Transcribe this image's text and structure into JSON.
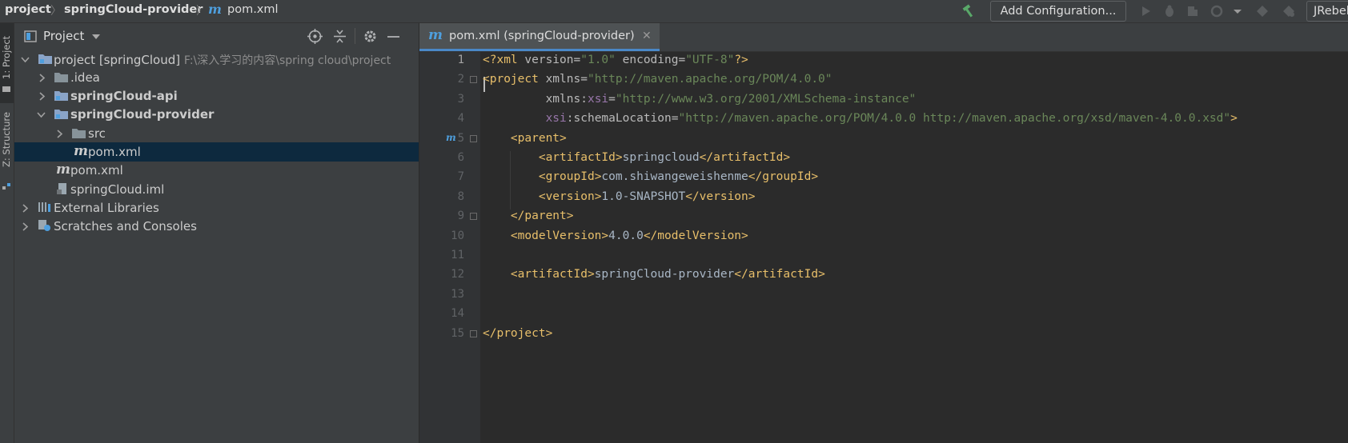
{
  "breadcrumb": {
    "root": "project",
    "module": "springCloud-provider",
    "file": "pom.xml"
  },
  "toolbar": {
    "add_configuration": "Add Configuration...",
    "jrebel": "JRebel",
    "icons": [
      "build-hammer-icon",
      "run-icon",
      "debug-icon",
      "coverage-icon",
      "profile-icon",
      "dropdown-icon",
      "jrebel-run-icon",
      "jrebel-debug-icon"
    ]
  },
  "stripe": {
    "project_label": "1: Project",
    "structure_label": "Z: Structure"
  },
  "project_panel": {
    "title": "Project",
    "tree": [
      {
        "label": "project [springCloud]",
        "path": "F:\\深入学习的内容\\spring cloud\\project",
        "icon": "module-folder-icon",
        "expanded": true
      },
      {
        "label": ".idea",
        "icon": "folder-icon",
        "expanded": false
      },
      {
        "label": "springCloud-api",
        "icon": "module-folder-icon",
        "expanded": false
      },
      {
        "label": "springCloud-provider",
        "icon": "module-folder-icon",
        "expanded": true
      },
      {
        "label": "src",
        "icon": "folder-icon",
        "expanded": false
      },
      {
        "label": "pom.xml",
        "icon": "maven-icon",
        "selected": true
      },
      {
        "label": "pom.xml",
        "icon": "maven-icon"
      },
      {
        "label": "springCloud.iml",
        "icon": "iml-file-icon"
      },
      {
        "label": "External Libraries",
        "icon": "libraries-icon",
        "expanded": false
      },
      {
        "label": "Scratches and Consoles",
        "icon": "scratches-icon",
        "expanded": false
      }
    ]
  },
  "editor": {
    "tab_label": "pom.xml (springCloud-provider)",
    "lines": [
      {
        "n": "1",
        "text": "<?xml version=\"1.0\" encoding=\"UTF-8\"?>"
      },
      {
        "n": "2",
        "text": "<project xmlns=\"http://maven.apache.org/POM/4.0.0\""
      },
      {
        "n": "3",
        "text": "         xmlns:xsi=\"http://www.w3.org/2001/XMLSchema-instance\""
      },
      {
        "n": "4",
        "text": "         xsi:schemaLocation=\"http://maven.apache.org/POM/4.0.0 http://maven.apache.org/xsd/maven-4.0.0.xsd\">"
      },
      {
        "n": "5",
        "text": "    <parent>"
      },
      {
        "n": "6",
        "text": "        <artifactId>springcloud</artifactId>"
      },
      {
        "n": "7",
        "text": "        <groupId>com.shiwangeweishenme</groupId>"
      },
      {
        "n": "8",
        "text": "        <version>1.0-SNAPSHOT</version>"
      },
      {
        "n": "9",
        "text": "    </parent>"
      },
      {
        "n": "10",
        "text": "    <modelVersion>4.0.0</modelVersion>"
      },
      {
        "n": "11",
        "text": ""
      },
      {
        "n": "12",
        "text": "    <artifactId>springCloud-provider</artifactId>"
      },
      {
        "n": "13",
        "text": ""
      },
      {
        "n": "14",
        "text": ""
      },
      {
        "n": "15",
        "text": "</project>"
      }
    ]
  }
}
